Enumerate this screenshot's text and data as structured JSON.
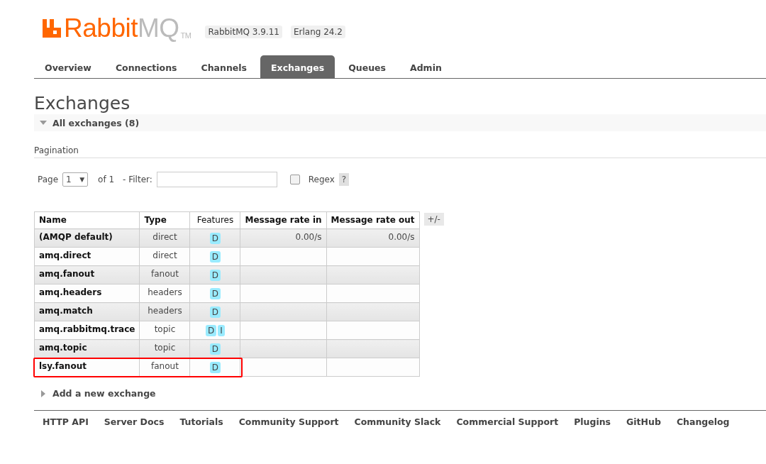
{
  "logo": {
    "brand": "Rabbit",
    "suffix": "MQ",
    "mark": "TM"
  },
  "versions": [
    "RabbitMQ 3.9.11",
    "Erlang 24.2"
  ],
  "tabs": [
    {
      "label": "Overview",
      "selected": false
    },
    {
      "label": "Connections",
      "selected": false
    },
    {
      "label": "Channels",
      "selected": false
    },
    {
      "label": "Exchanges",
      "selected": true
    },
    {
      "label": "Queues",
      "selected": false
    },
    {
      "label": "Admin",
      "selected": false
    }
  ],
  "heading": "Exchanges",
  "section": {
    "title": "All exchanges (8)",
    "expanded": true
  },
  "pagination": {
    "title": "Pagination",
    "page_label": "Page",
    "page": "1",
    "page_caret": "▼",
    "of_label": "of 1",
    "filter_label": "- Filter:",
    "regex": {
      "label": "Regex",
      "checked": false
    },
    "help": "?"
  },
  "table": {
    "columns": [
      "Name",
      "Type",
      "Features",
      "Message rate in",
      "Message rate out"
    ],
    "toggle": "+/-",
    "rows": [
      {
        "name": "(AMQP default)",
        "type": "direct",
        "features": [
          "D"
        ],
        "rate_in": "0.00/s",
        "rate_out": "0.00/s",
        "highlighted": false
      },
      {
        "name": "amq.direct",
        "type": "direct",
        "features": [
          "D"
        ],
        "highlighted": false
      },
      {
        "name": "amq.fanout",
        "type": "fanout",
        "features": [
          "D"
        ],
        "highlighted": false
      },
      {
        "name": "amq.headers",
        "type": "headers",
        "features": [
          "D"
        ],
        "highlighted": false
      },
      {
        "name": "amq.match",
        "type": "headers",
        "features": [
          "D"
        ],
        "highlighted": false
      },
      {
        "name": "amq.rabbitmq.trace",
        "type": "topic",
        "features": [
          "D",
          "I"
        ],
        "highlighted": false
      },
      {
        "name": "amq.topic",
        "type": "topic",
        "features": [
          "D"
        ],
        "highlighted": false
      },
      {
        "name": "lsy.fanout",
        "type": "fanout",
        "features": [
          "D"
        ],
        "highlighted": true
      }
    ]
  },
  "add_section": {
    "title": "Add a new exchange",
    "expanded": false
  },
  "footer": [
    "HTTP API",
    "Server Docs",
    "Tutorials",
    "Community Support",
    "Community Slack",
    "Commercial Support",
    "Plugins",
    "GitHub",
    "Changelog"
  ]
}
